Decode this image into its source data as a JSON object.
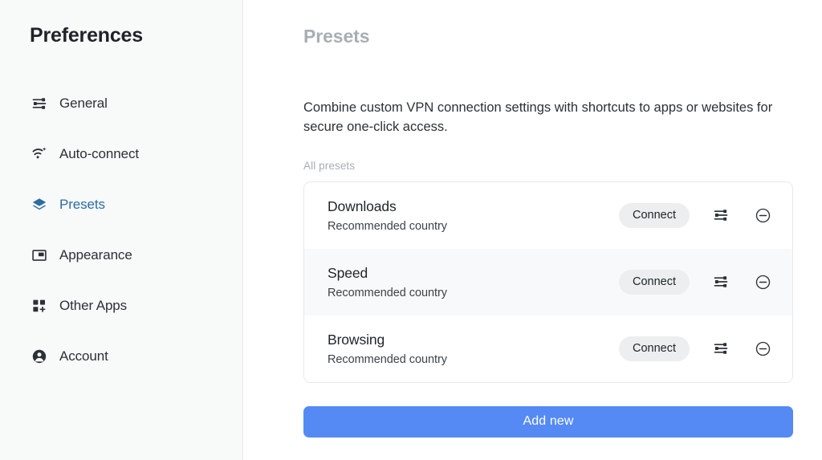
{
  "sidebar": {
    "title": "Preferences",
    "items": [
      {
        "label": "General",
        "icon": "sliders-icon",
        "active": false
      },
      {
        "label": "Auto-connect",
        "icon": "wifi-sparkle-icon",
        "active": false
      },
      {
        "label": "Presets",
        "icon": "layers-icon",
        "active": true
      },
      {
        "label": "Appearance",
        "icon": "window-icon",
        "active": false
      },
      {
        "label": "Other Apps",
        "icon": "grid-plus-icon",
        "active": false
      },
      {
        "label": "Account",
        "icon": "user-circle-icon",
        "active": false
      }
    ]
  },
  "main": {
    "title": "Presets",
    "description": "Combine custom VPN connection settings with shortcuts to apps or websites for secure one-click access.",
    "section_label": "All presets",
    "presets": [
      {
        "name": "Downloads",
        "subtitle": "Recommended country",
        "connect_label": "Connect",
        "settings_icon": "sliders-icon",
        "remove_icon": "minus-circle-icon"
      },
      {
        "name": "Speed",
        "subtitle": "Recommended country",
        "connect_label": "Connect",
        "settings_icon": "sliders-icon",
        "remove_icon": "minus-circle-icon"
      },
      {
        "name": "Browsing",
        "subtitle": "Recommended country",
        "connect_label": "Connect",
        "settings_icon": "sliders-icon",
        "remove_icon": "minus-circle-icon"
      }
    ],
    "add_new_label": "Add new"
  },
  "colors": {
    "accent_blue": "#558af4",
    "active_nav": "#2b6ca3",
    "sidebar_bg": "#f8f9f9",
    "pill_bg": "#eceef0",
    "muted_text": "#a8aeb4"
  }
}
